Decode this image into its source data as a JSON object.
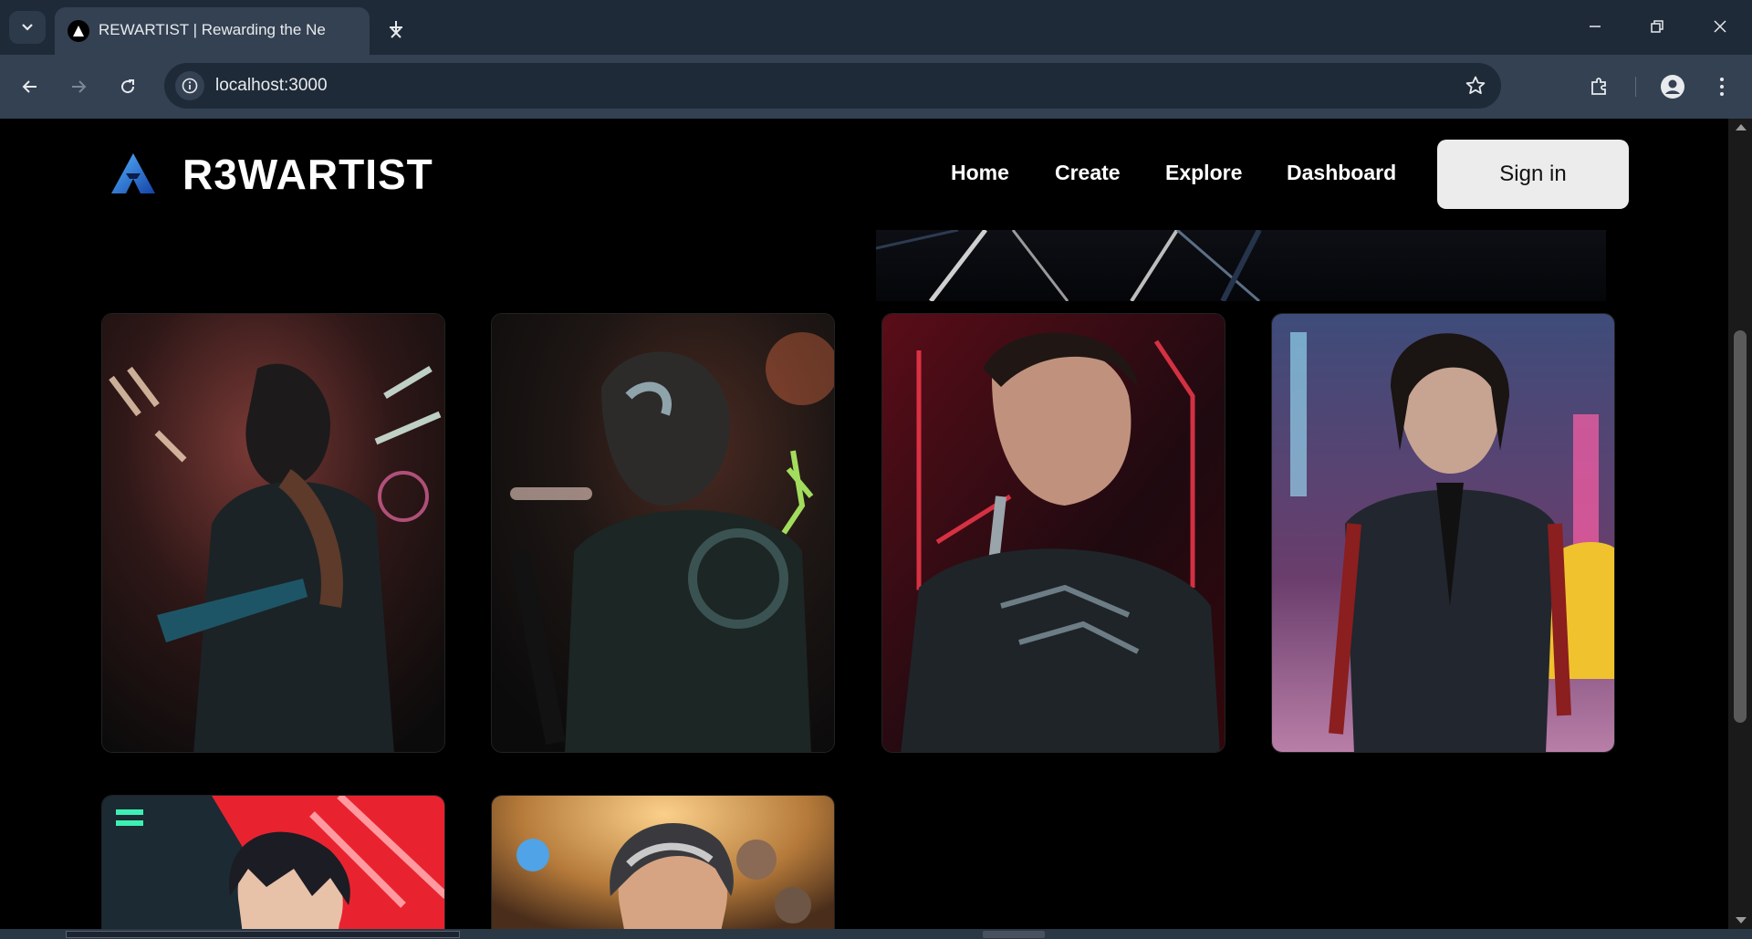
{
  "browser": {
    "tab_title": "REWARTIST | Rewarding the Ne",
    "url": "localhost:3000"
  },
  "site": {
    "brand": "R3WARTIST",
    "nav": [
      {
        "label": "Home"
      },
      {
        "label": "Create"
      },
      {
        "label": "Explore"
      },
      {
        "label": "Dashboard"
      }
    ],
    "signin_label": "Sign in"
  },
  "gallery": {
    "items": [
      {
        "icon": "cyberpunk-gunman-artwork",
        "accent": "#d8654a"
      },
      {
        "icon": "cyborg-warrior-artwork",
        "accent": "#2f9c8a"
      },
      {
        "icon": "cyborg-man-red-neon-artwork",
        "accent": "#c21e3a"
      },
      {
        "icon": "cyborg-john-wick-rain-artwork",
        "accent": "#e43c8c"
      },
      {
        "icon": "red-anime-man-artwork",
        "accent": "#e8232f"
      },
      {
        "icon": "gray-hair-man-fantasy-artwork",
        "accent": "#d9952f"
      }
    ]
  },
  "colors": {
    "chrome_dark": "#1e2a38",
    "chrome_mid": "#334152",
    "page_bg": "#000000",
    "signin_bg": "#ececec"
  }
}
